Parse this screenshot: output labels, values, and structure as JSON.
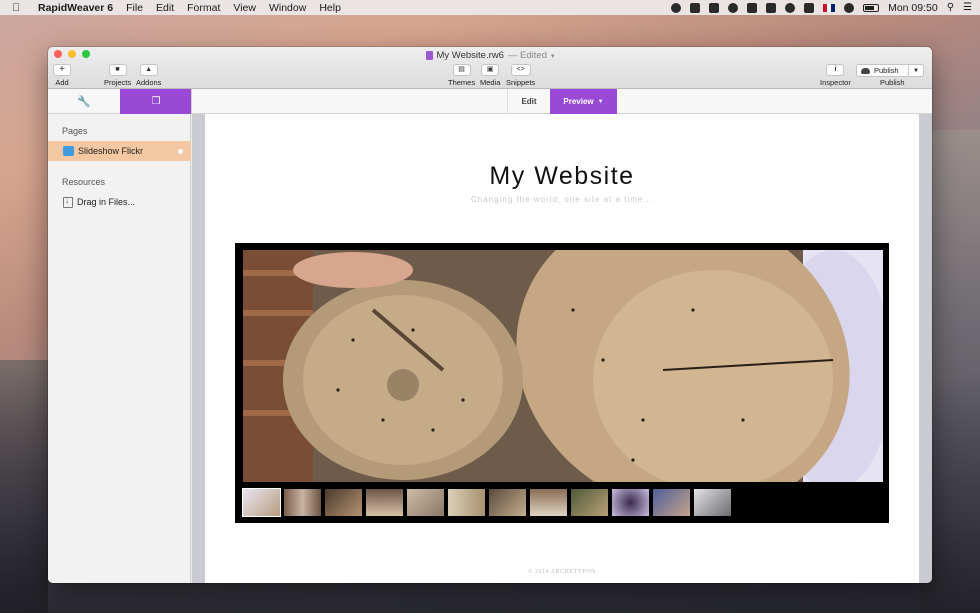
{
  "menubar": {
    "app_name": "RapidWeaver 6",
    "menus": [
      "File",
      "Edit",
      "Format",
      "View",
      "Window",
      "Help"
    ],
    "clock": "Mon 09:50"
  },
  "window": {
    "doc_title": "My Website.rw6",
    "doc_status": "— Edited",
    "toolbar": {
      "add": "Add",
      "projects": "Projects",
      "addons": "Addons",
      "themes": "Themes",
      "media": "Media",
      "snippets": "Snippets",
      "inspector": "Inspector",
      "publish_button": "Publish",
      "publish_label": "Publish"
    },
    "modes": {
      "edit": "Edit",
      "preview": "Preview"
    }
  },
  "sidebar": {
    "pages_header": "Pages",
    "pages": [
      {
        "label": "Slideshow Flickr",
        "icon": "home-icon",
        "selected": true
      }
    ],
    "resources_header": "Resources",
    "resources_action": "Drag in Files..."
  },
  "preview": {
    "site_title": "My Website",
    "tagline": "Changing the world, one site at a time...",
    "footer": "© 2014 ARCHETYPON"
  },
  "colors": {
    "accent": "#9a48d6",
    "selected_row": "#f3c8a3"
  }
}
